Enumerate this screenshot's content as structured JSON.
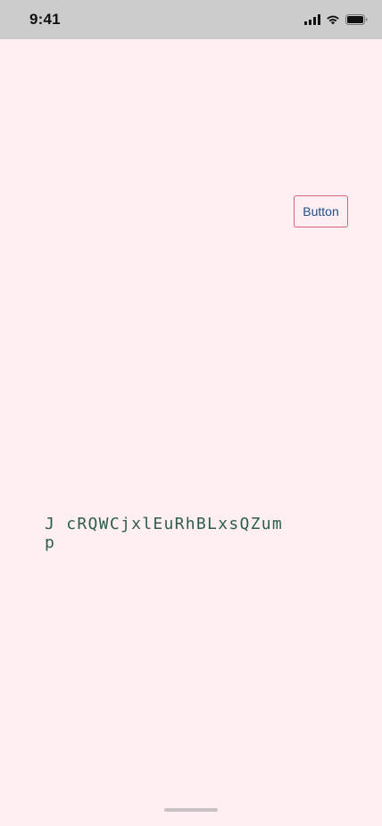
{
  "status_bar": {
    "time": "9:41",
    "icons": [
      "signal-icon",
      "wifi-icon",
      "battery-icon"
    ]
  },
  "main": {
    "button_label": "Button",
    "mono_text": "J cRQWCjxlEuRhBLxsQZum\np"
  },
  "colors": {
    "background": "#ffeff3",
    "status_bar": "#cccccc",
    "button_border": "#d9627a",
    "button_text": "#1a4e8c",
    "mono_text": "#2e5e4a"
  }
}
